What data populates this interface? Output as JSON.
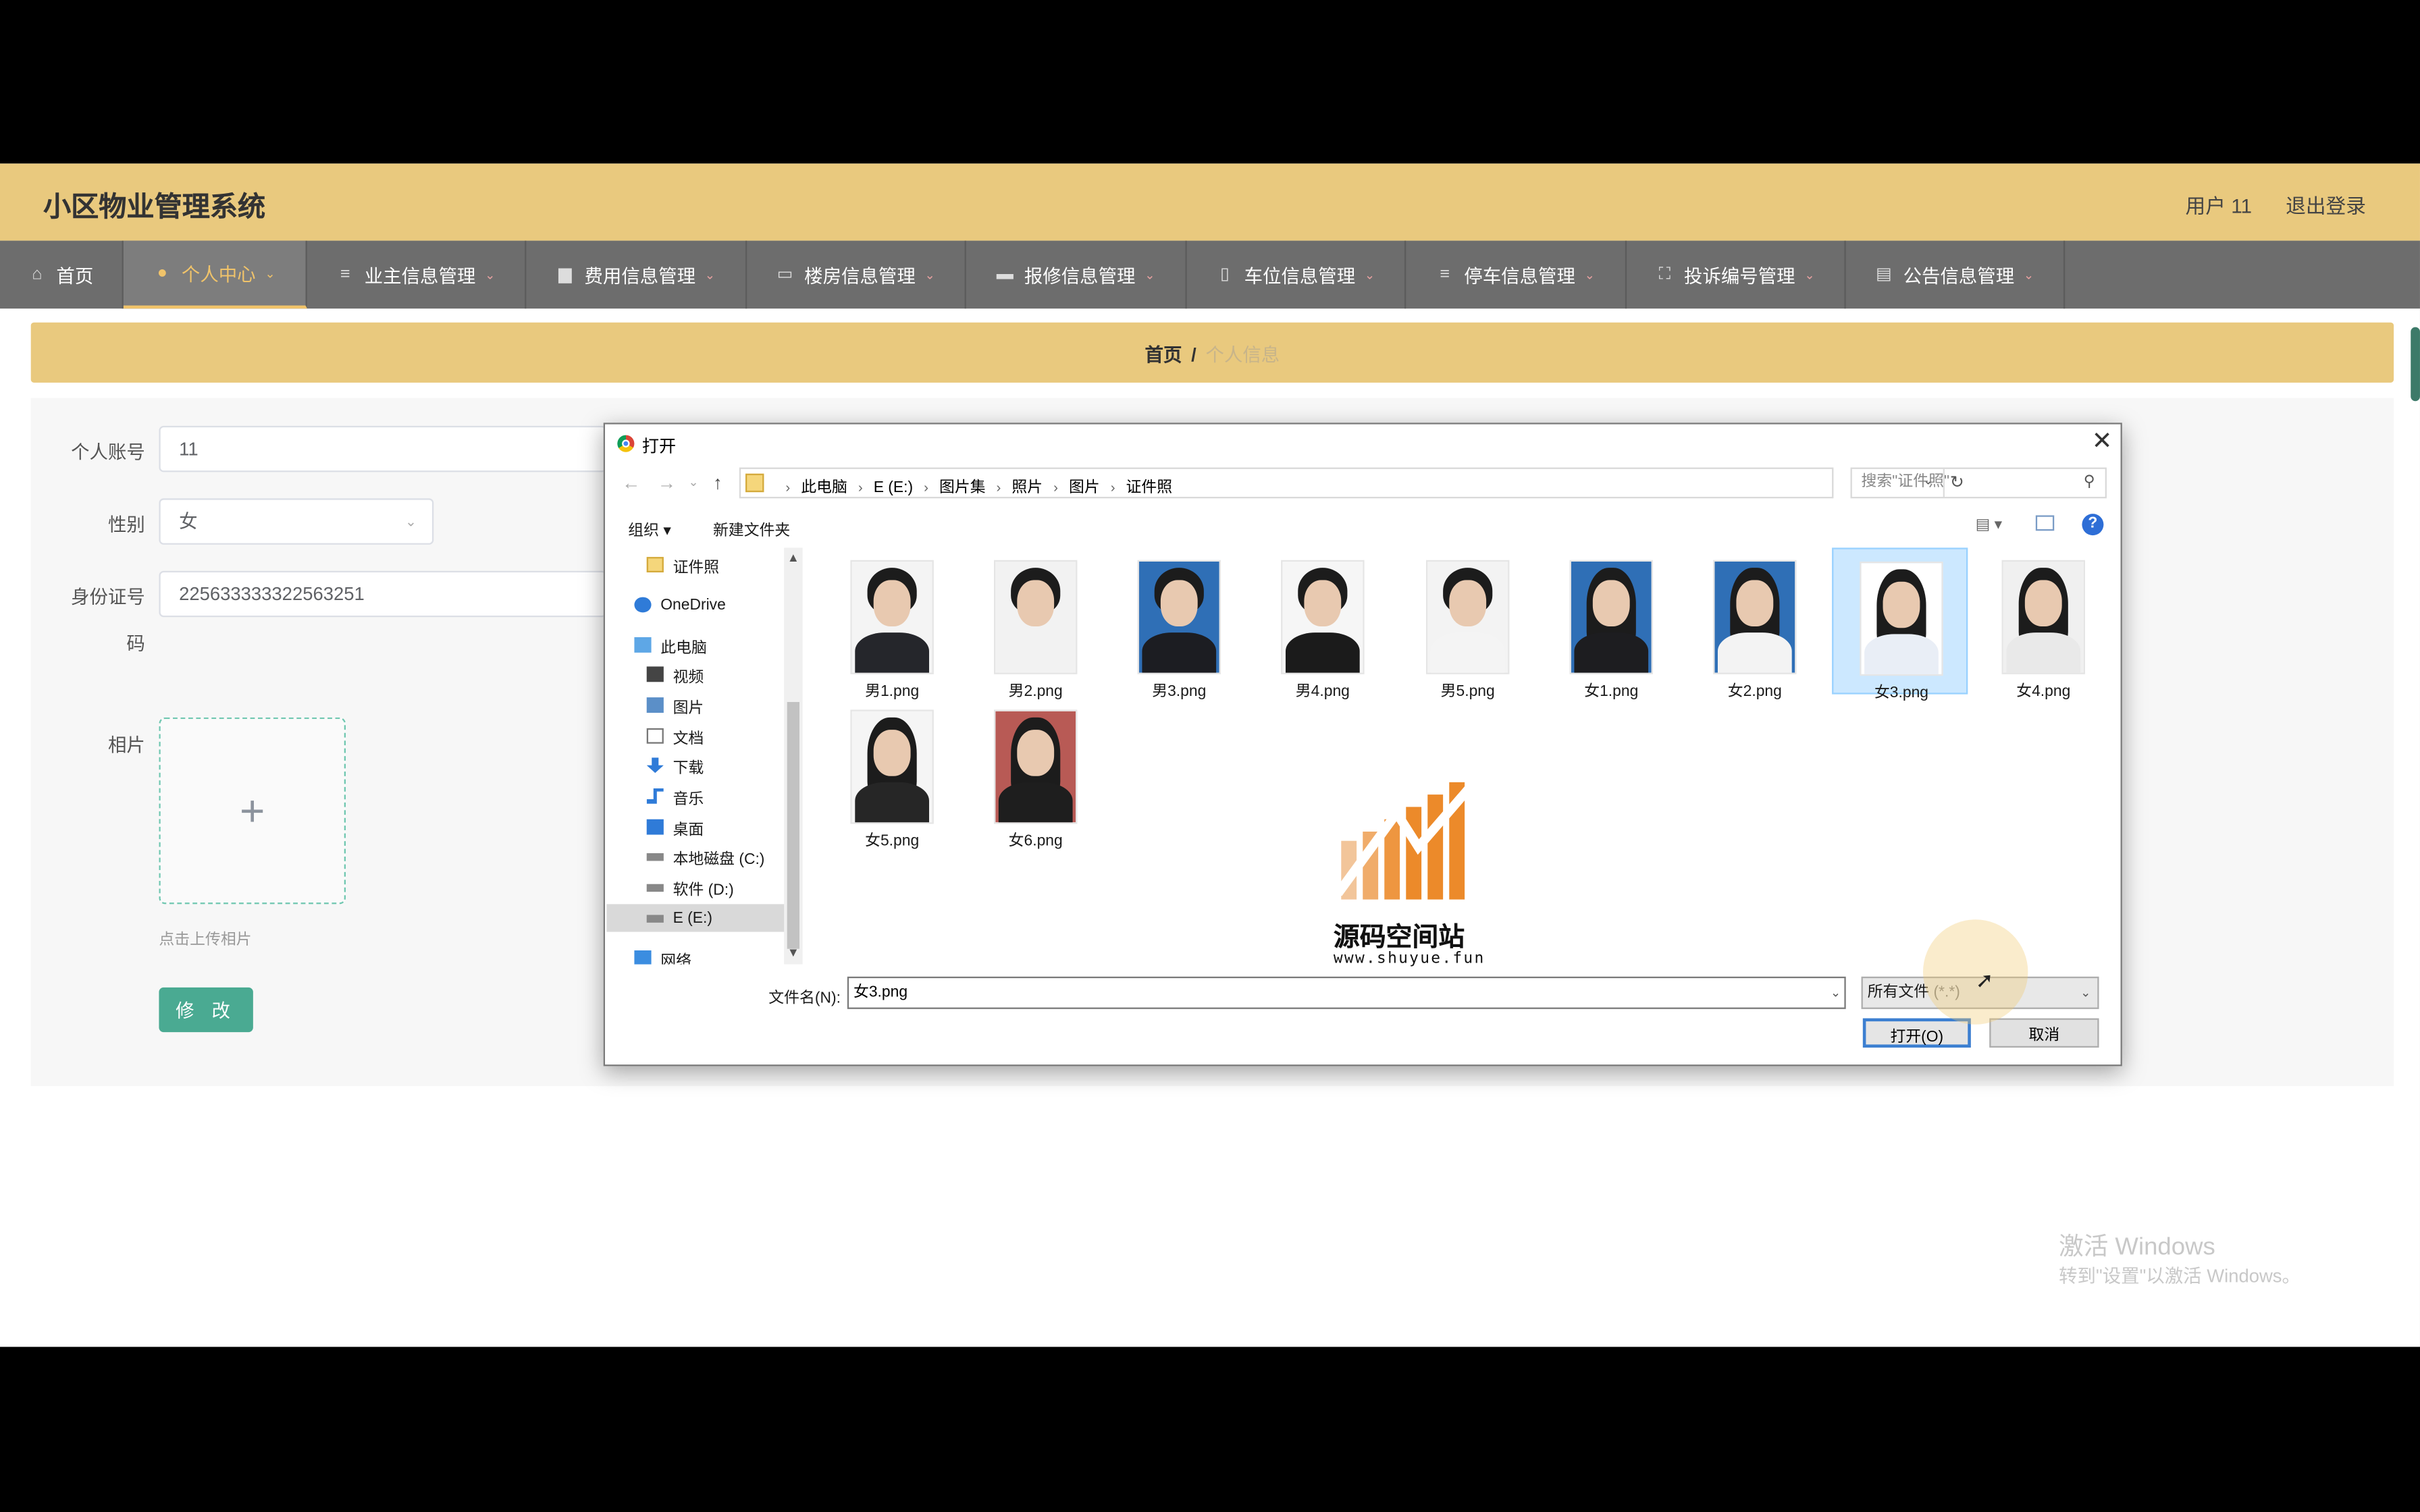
{
  "header": {
    "app_title": "小区物业管理系统",
    "user": "用户 11",
    "logout": "退出登录"
  },
  "nav": {
    "items": [
      {
        "label": "首页",
        "icon": "home-icon"
      },
      {
        "label": "个人中心",
        "icon": "user-icon"
      },
      {
        "label": "业主信息管理",
        "icon": "list-icon"
      },
      {
        "label": "费用信息管理",
        "icon": "printer-icon"
      },
      {
        "label": "楼房信息管理",
        "icon": "chat-icon"
      },
      {
        "label": "报修信息管理",
        "icon": "briefcase-icon"
      },
      {
        "label": "车位信息管理",
        "icon": "phone-icon"
      },
      {
        "label": "停车信息管理",
        "icon": "list-icon"
      },
      {
        "label": "投诉编号管理",
        "icon": "fullscreen-icon"
      },
      {
        "label": "公告信息管理",
        "icon": "clipboard-icon"
      }
    ]
  },
  "breadcrumb": {
    "home": "首页",
    "sep": "/",
    "current": "个人信息"
  },
  "form": {
    "account_label": "个人账号",
    "account_value": "11",
    "gender_label": "性别",
    "gender_value": "女",
    "id_label_line1": "身份证号",
    "id_label_line2": "码",
    "id_value": "225633333322563251",
    "photo_label": "相片",
    "upload_plus": "+",
    "upload_tip": "点击上传相片",
    "submit": "修 改"
  },
  "dialog": {
    "title": "打开",
    "path": [
      "此电脑",
      "E (E:)",
      "图片集",
      "照片",
      "图片",
      "证件照"
    ],
    "search_placeholder": "搜索\"证件照\"",
    "toolbar": {
      "organize": "组织 ▾",
      "new_folder": "新建文件夹"
    },
    "tree": [
      {
        "label": "证件照",
        "icon": "folder-icon"
      },
      {
        "label": "OneDrive",
        "icon": "cloud-icon"
      },
      {
        "label": "此电脑",
        "icon": "computer-icon"
      },
      {
        "label": "视频",
        "icon": "video-icon"
      },
      {
        "label": "图片",
        "icon": "picture-icon"
      },
      {
        "label": "文档",
        "icon": "document-icon"
      },
      {
        "label": "下载",
        "icon": "download-icon"
      },
      {
        "label": "音乐",
        "icon": "music-icon"
      },
      {
        "label": "桌面",
        "icon": "desktop-icon"
      },
      {
        "label": "本地磁盘 (C:)",
        "icon": "drive-icon"
      },
      {
        "label": "软件 (D:)",
        "icon": "drive-icon"
      },
      {
        "label": "E (E:)",
        "icon": "drive-icon"
      },
      {
        "label": "网络",
        "icon": "network-icon"
      }
    ],
    "files": [
      {
        "name": "男1.png"
      },
      {
        "name": "男2.png"
      },
      {
        "name": "男3.png"
      },
      {
        "name": "男4.png"
      },
      {
        "name": "男5.png"
      },
      {
        "name": "女1.png"
      },
      {
        "name": "女2.png"
      },
      {
        "name": "女3.png"
      },
      {
        "name": "女4.png"
      },
      {
        "name": "女5.png"
      },
      {
        "name": "女6.png"
      }
    ],
    "selected_file": "女3.png",
    "filename_label": "文件名(N):",
    "filename_value": "女3.png",
    "filetype_label": "所有文件",
    "filetype_ext": "(*.*)",
    "open_button": "打开(O)",
    "cancel_button": "取消"
  },
  "brand_watermark": {
    "name": "源码空间站",
    "url": "www.shuyue.fun"
  },
  "windows_watermark": {
    "line1": "激活 Windows",
    "line2": "转到\"设置\"以激活 Windows。"
  },
  "colors": {
    "header": "#e9c97e",
    "nav": "#6d6d6d",
    "accent": "#f0c36a",
    "button": "#4aaa92"
  }
}
